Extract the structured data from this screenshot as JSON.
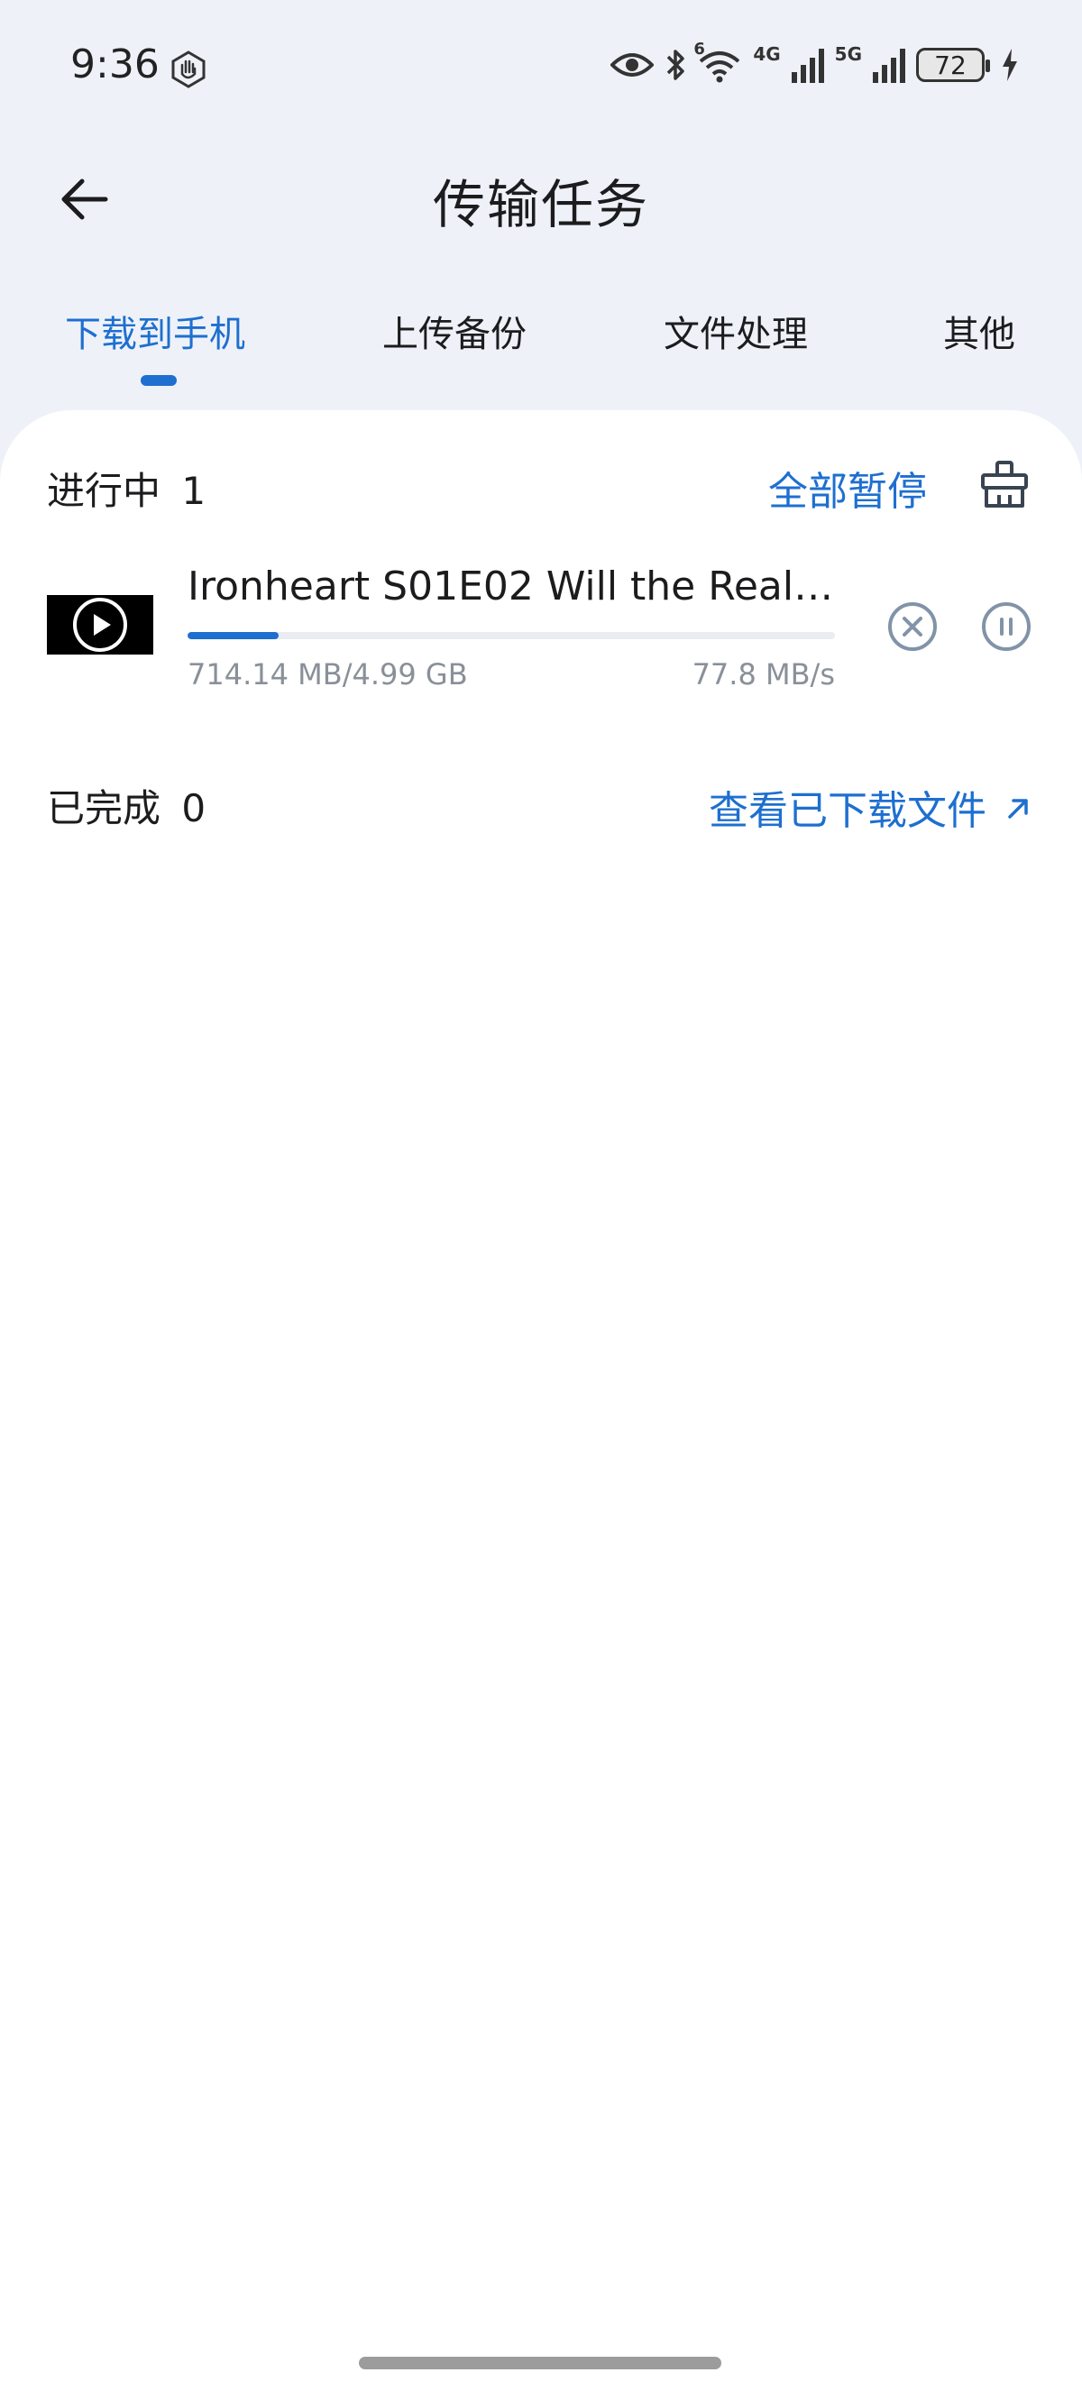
{
  "status_bar": {
    "time": "9:36",
    "network_1": "4G",
    "network_2": "5G",
    "wifi_badge": "6",
    "battery": "72"
  },
  "header": {
    "title": "传输任务"
  },
  "tabs": [
    {
      "label": "下载到手机",
      "active": true
    },
    {
      "label": "上传备份",
      "active": false
    },
    {
      "label": "文件处理",
      "active": false
    },
    {
      "label": "其他",
      "active": false
    }
  ],
  "in_progress": {
    "label": "进行中",
    "count": "1",
    "pause_all": "全部暂停"
  },
  "task": {
    "name": "Ironheart S01E02 Will the Real ...",
    "size": "714.14 MB/4.99 GB",
    "speed": "77.8 MB/s",
    "progress_fraction": 0.14
  },
  "completed": {
    "label": "已完成",
    "count": "0",
    "view_files": "查看已下载文件"
  },
  "colors": {
    "accent": "#1e6fd0",
    "background": "#eef2f8",
    "card": "#ffffff",
    "muted_text": "#8a9099"
  }
}
